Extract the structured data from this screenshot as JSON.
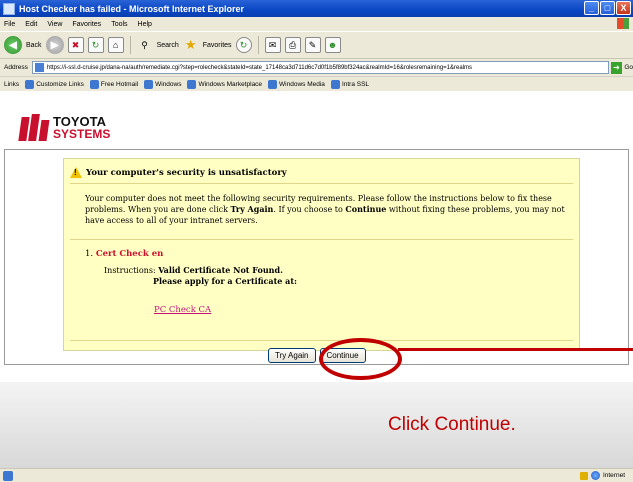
{
  "window": {
    "title": "Host Checker has failed - Microsoft Internet Explorer",
    "controls": {
      "minimize": "_",
      "maximize": "□",
      "close": "X"
    }
  },
  "menu": [
    "File",
    "Edit",
    "View",
    "Favorites",
    "Tools",
    "Help"
  ],
  "toolbar": {
    "back": "Back",
    "search": "Search",
    "favorites": "Favorites"
  },
  "address": {
    "label": "Address",
    "url": "https://i-ssl.d-cruise.jp/dana-na/auth/remediate.cgi?step=rolecheck&stateId=state_17148ca3d711d6c7d0f1b5f89bf324ac&realmId=16&rolesremaining=1&realms",
    "go": "Go"
  },
  "links": {
    "label": "Links",
    "items": [
      "Customize Links",
      "Free Hotmail",
      "Windows",
      "Windows Marketplace",
      "Windows Media",
      "Intra SSL"
    ]
  },
  "logo": {
    "line1": "TOYOTA",
    "line2": "SYSTEMS"
  },
  "warning": {
    "heading": "Your computer's security is unsatisfactory",
    "msg_part1": "Your computer does not meet the following security requirements. Please follow the instructions below to fix these problems. When you are done click ",
    "try_again_inline": "Try Again",
    "msg_part2": ". If you choose to ",
    "continue_inline": "Continue",
    "msg_part3": " without fixing these problems, you may not have access to all of your intranet servers.",
    "req_number": "1.",
    "req_name": "Cert Check en",
    "instructions_label": "Instructions:",
    "instructions_line1": "Valid Certificate Not Found.",
    "instructions_line2": "Please apply for a Certificate at:",
    "link_text": "PC Check CA"
  },
  "buttons": {
    "try_again": "Try Again",
    "continue": "Continue"
  },
  "annotation": {
    "callout": "Click Continue.",
    "color": "#c00000"
  },
  "status": {
    "zone": "Internet"
  }
}
